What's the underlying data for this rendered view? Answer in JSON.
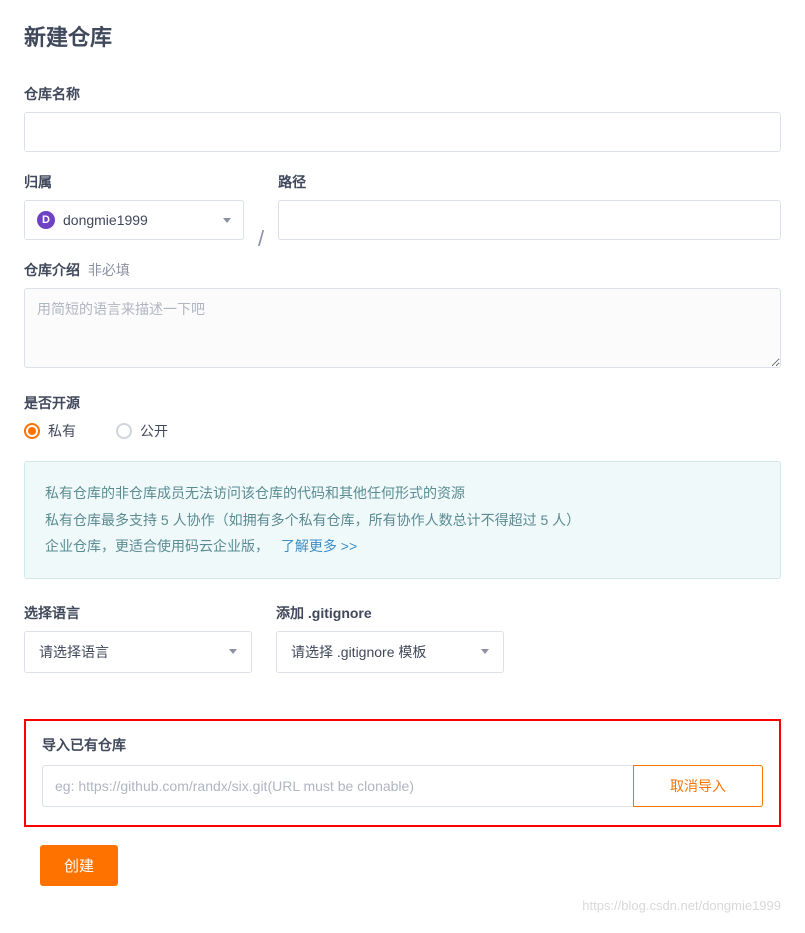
{
  "page": {
    "title": "新建仓库"
  },
  "repo_name": {
    "label": "仓库名称"
  },
  "owner": {
    "label": "归属",
    "avatar_letter": "D",
    "name": "dongmie1999"
  },
  "path": {
    "label": "路径"
  },
  "description": {
    "label": "仓库介绍",
    "optional": "非必填",
    "placeholder": "用简短的语言来描述一下吧"
  },
  "visibility": {
    "label": "是否开源",
    "options": {
      "private": "私有",
      "public": "公开"
    },
    "selected": "private"
  },
  "info": {
    "line1": "私有仓库的非仓库成员无法访问该仓库的代码和其他任何形式的资源",
    "line2": "私有仓库最多支持 5 人协作（如拥有多个私有仓库，所有协作人数总计不得超过 5 人）",
    "line3": "企业仓库，更适合使用码云企业版，",
    "link": "了解更多 >>"
  },
  "language": {
    "label": "选择语言",
    "placeholder": "请选择语言"
  },
  "gitignore": {
    "label": "添加 .gitignore",
    "placeholder": "请选择 .gitignore 模板"
  },
  "import": {
    "title": "导入已有仓库",
    "placeholder": "eg: https://github.com/randx/six.git(URL must be clonable)",
    "cancel": "取消导入"
  },
  "create_button": "创建",
  "watermark": "https://blog.csdn.net/dongmie1999"
}
